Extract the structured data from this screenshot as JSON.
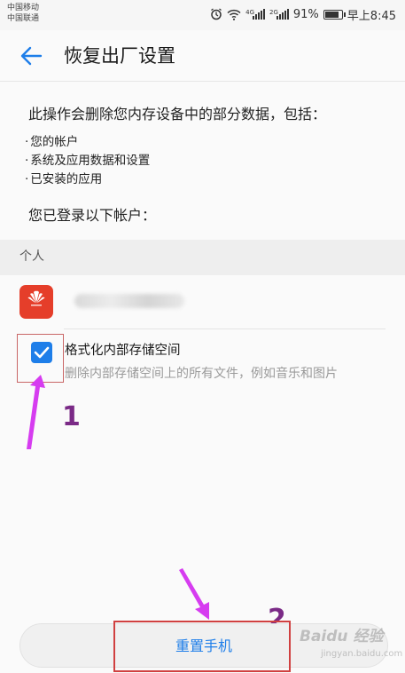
{
  "status_bar": {
    "carrier_1": "中国移动",
    "carrier_2": "中国联通",
    "signal_tag_1": "4G",
    "signal_tag_2": "2G",
    "battery_percent": "91%",
    "battery_level": 0.91,
    "time": "早上8:45",
    "icons": [
      "alarm-icon",
      "wifi-icon",
      "signal-icon",
      "battery-icon"
    ]
  },
  "header": {
    "back_icon": "arrow-left-icon",
    "title": "恢复出厂设置"
  },
  "content": {
    "description": "此操作会删除您内存设备中的部分数据，包括：",
    "bullets": [
      "您的帐户",
      "系统及应用数据和设置",
      "已安装的应用"
    ],
    "logged_in_label": "您已登录以下帐户："
  },
  "accounts": {
    "section_title": "个人",
    "items": [
      {
        "logo_icon": "huawei-logo-icon",
        "logo_color": "#e53e2a"
      }
    ]
  },
  "option": {
    "checked": true,
    "title": "格式化内部存储空间",
    "description": "删除内部存储空间上的所有文件，例如音乐和图片"
  },
  "annotations": {
    "marker_1": "1",
    "marker_2": "2",
    "color": "#7a2a86",
    "highlight_color": "#d04040"
  },
  "footer": {
    "reset_button_label": "重置手机"
  },
  "watermark": {
    "text": "Baidu 经验",
    "sub": "jingyan.baidu.com"
  },
  "colors": {
    "accent": "#1e7ee9",
    "background": "#fafafa",
    "section_bg": "#eeeeee"
  }
}
